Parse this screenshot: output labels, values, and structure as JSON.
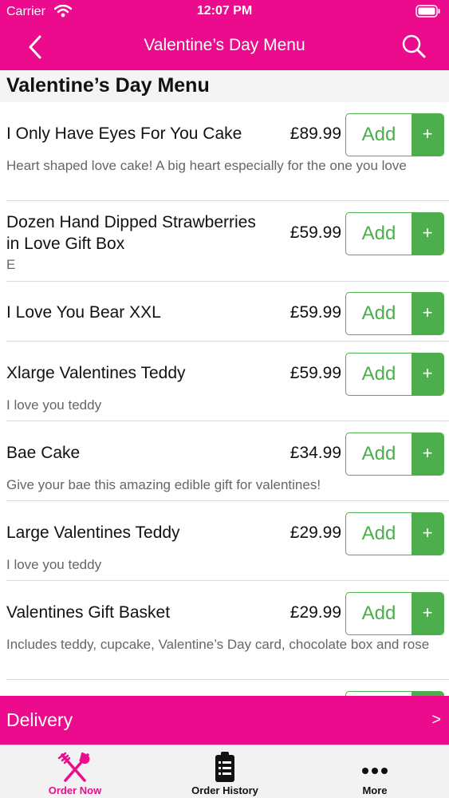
{
  "status": {
    "carrier": "Carrier",
    "time": "12:07 PM"
  },
  "nav": {
    "title": "Valentine’s Day Menu"
  },
  "section": {
    "title": "Valentine’s Day Menu"
  },
  "items": [
    {
      "name": "I Only Have Eyes For You Cake",
      "price": "£89.99",
      "desc": "Heart shaped love cake! A big heart especially for the one you love",
      "add": "Add",
      "plus": "+"
    },
    {
      "name": "Dozen Hand Dipped Strawberries in Love Gift Box",
      "price": "£59.99",
      "desc": "E",
      "add": "Add",
      "plus": "+"
    },
    {
      "name": "I Love You Bear XXL",
      "price": "£59.99",
      "desc": "",
      "add": "Add",
      "plus": "+"
    },
    {
      "name": "Xlarge Valentines Teddy",
      "price": "£59.99",
      "desc": "I love you teddy",
      "add": "Add",
      "plus": "+"
    },
    {
      "name": "Bae Cake",
      "price": "£34.99",
      "desc": "Give your bae this amazing edible gift for valentines!",
      "add": "Add",
      "plus": "+"
    },
    {
      "name": "Large Valentines Teddy",
      "price": "£29.99",
      "desc": "I love you teddy",
      "add": "Add",
      "plus": "+"
    },
    {
      "name": "Valentines Gift Basket",
      "price": "£29.99",
      "desc": "Includes teddy, cupcake, Valentine’s Day card, chocolate box and rose",
      "add": "Add",
      "plus": "+"
    }
  ],
  "delivery": {
    "label": "Delivery",
    "chevron": ">"
  },
  "tabs": [
    {
      "label": "Order Now",
      "icon": "fork-knife-icon",
      "active": true
    },
    {
      "label": "Order History",
      "icon": "clipboard-list-icon",
      "active": false
    },
    {
      "label": "More",
      "icon": "more-dots-icon",
      "active": false
    }
  ],
  "colors": {
    "brand": "#eb0b8c",
    "accent": "#4cae4c"
  }
}
